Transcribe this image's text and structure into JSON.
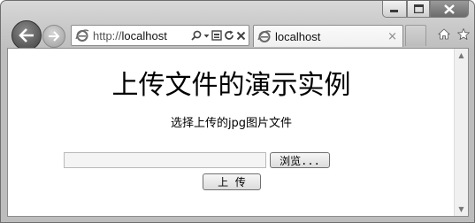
{
  "window": {
    "minimize_icon": "minimize-icon",
    "maximize_icon": "maximize-icon",
    "close_icon": "close-icon"
  },
  "nav": {
    "back_icon": "back-arrow-icon",
    "forward_icon": "forward-arrow-icon"
  },
  "address_bar": {
    "scheme": "http://",
    "host": "localhost",
    "tools": [
      "search-icon",
      "dropdown-icon",
      "compatibility-icon",
      "refresh-icon",
      "stop-icon"
    ]
  },
  "tabs": [
    {
      "label": "localhost",
      "active": true,
      "close_glyph": "×"
    }
  ],
  "toolbar": {
    "home_icon": "home-icon",
    "favorites_icon": "star-icon"
  },
  "page": {
    "heading": "上传文件的演示实例",
    "subtitle": "选择上传的jpg图片文件",
    "file_input_value": "",
    "browse_label": "浏览...",
    "upload_label": "上  传"
  },
  "colors": {
    "frame": "#c9c9c9",
    "back_button": "#4a4a4a",
    "content_bg": "#ffffff"
  }
}
